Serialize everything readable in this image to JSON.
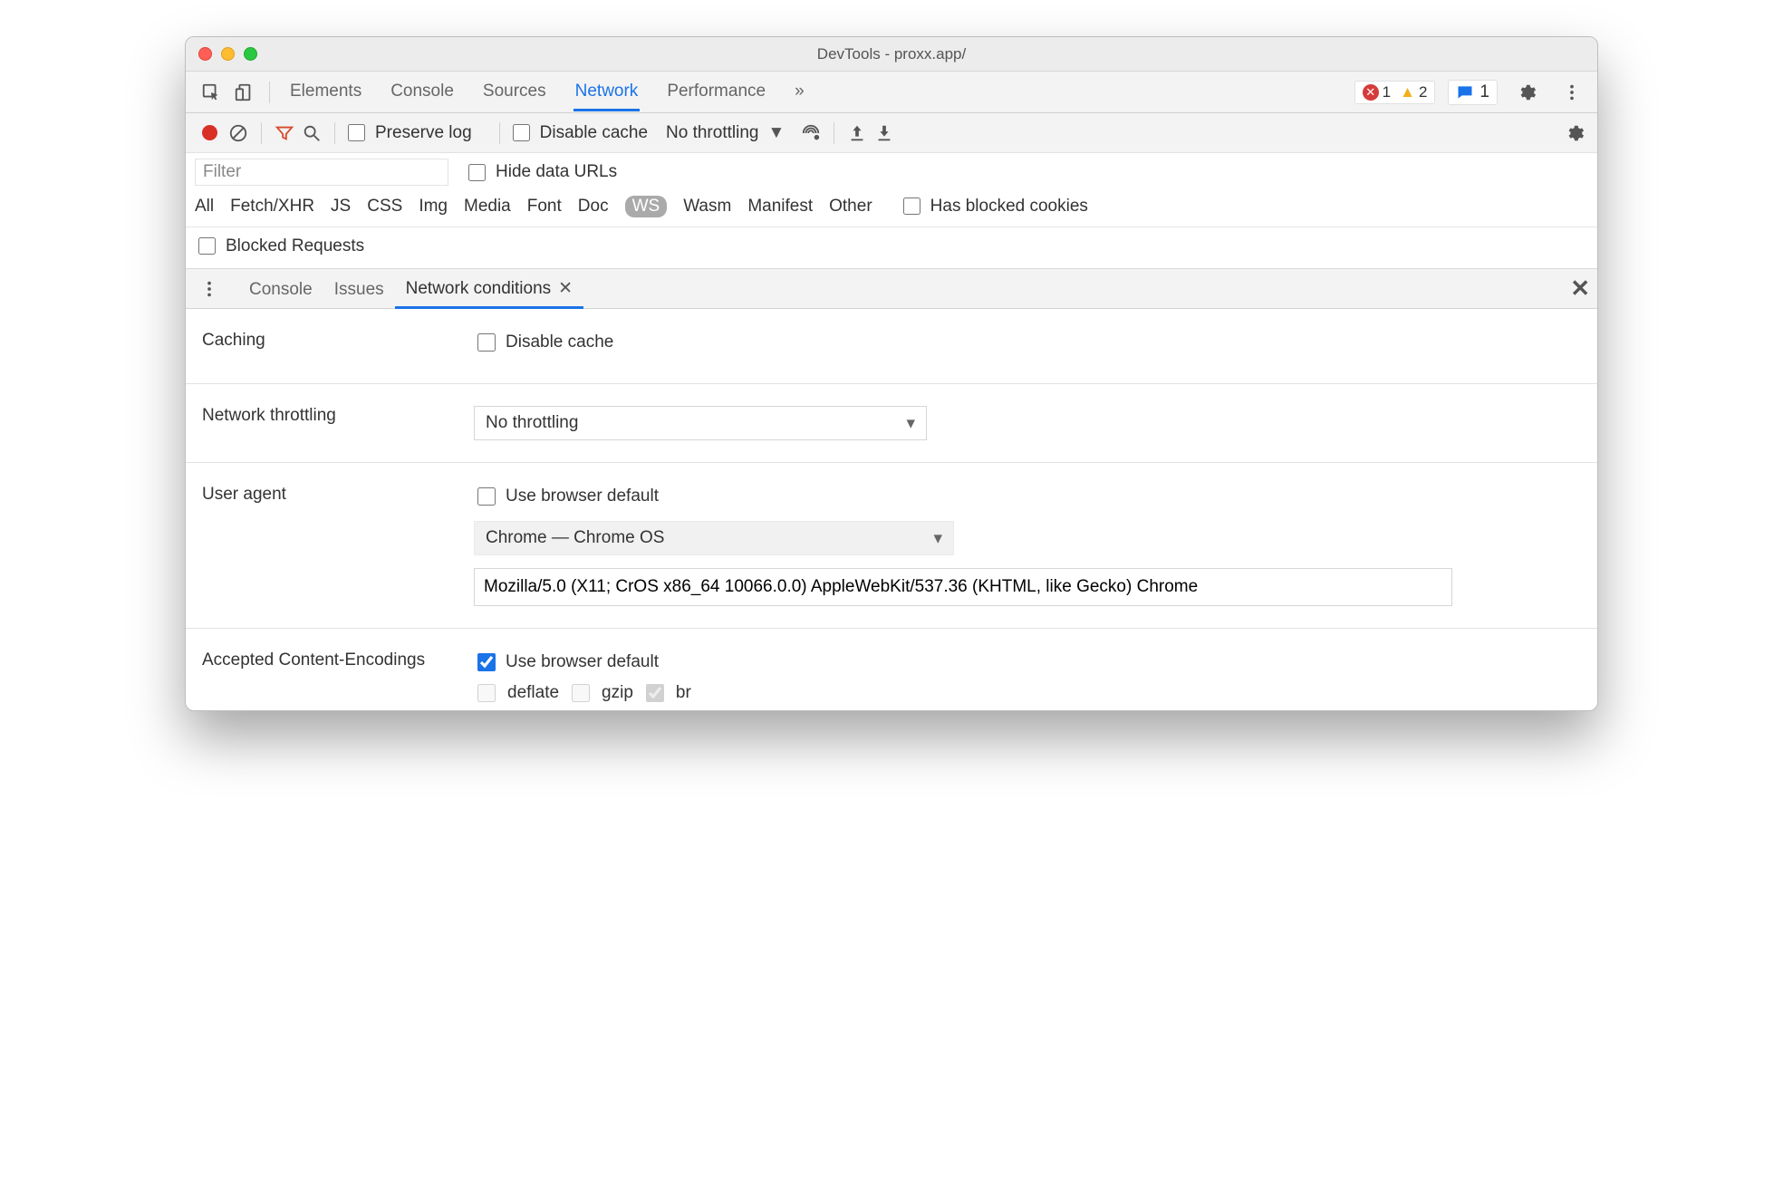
{
  "window": {
    "title": "DevTools - proxx.app/"
  },
  "mainTabs": {
    "items": [
      "Elements",
      "Console",
      "Sources",
      "Network",
      "Performance"
    ],
    "active": "Network",
    "more_icon": "»"
  },
  "badges": {
    "errors": "1",
    "warnings": "2",
    "messages": "1"
  },
  "networkToolbar": {
    "preserve_log": "Preserve log",
    "disable_cache": "Disable cache",
    "throttling": "No throttling"
  },
  "filter": {
    "placeholder": "Filter",
    "hide_data_urls": "Hide data URLs",
    "types": [
      "All",
      "Fetch/XHR",
      "JS",
      "CSS",
      "Img",
      "Media",
      "Font",
      "Doc",
      "WS",
      "Wasm",
      "Manifest",
      "Other"
    ],
    "active_type": "WS",
    "has_blocked": "Has blocked cookies",
    "blocked_requests": "Blocked Requests"
  },
  "drawer": {
    "tabs": [
      "Console",
      "Issues",
      "Network conditions"
    ],
    "active": "Network conditions"
  },
  "conditions": {
    "caching_label": "Caching",
    "caching_disable": "Disable cache",
    "throttling_label": "Network throttling",
    "throttling_value": "No throttling",
    "ua_label": "User agent",
    "ua_use_default": "Use browser default",
    "ua_select": "Chrome — Chrome OS",
    "ua_string": "Mozilla/5.0 (X11; CrOS x86_64 10066.0.0) AppleWebKit/537.36 (KHTML, like Gecko) Chrome",
    "enc_label": "Accepted Content-Encodings",
    "enc_use_default": "Use browser default",
    "enc_deflate": "deflate",
    "enc_gzip": "gzip",
    "enc_br": "br"
  }
}
